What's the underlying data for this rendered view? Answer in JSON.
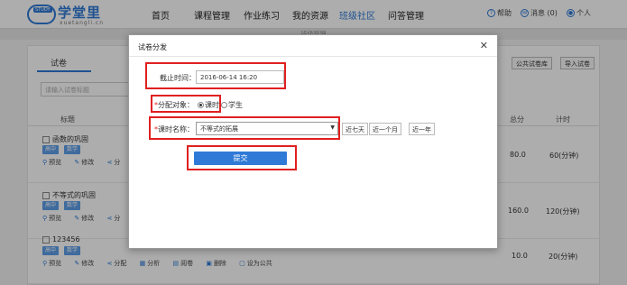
{
  "logo": {
    "badge": "STUDY",
    "name": "学堂里",
    "sub": "xuetangli.cn"
  },
  "nav": [
    {
      "label": "首页"
    },
    {
      "label": "课程管理"
    },
    {
      "label": "作业练习"
    },
    {
      "label": "我的资源"
    },
    {
      "label": "班级社区"
    },
    {
      "label": "问答管理"
    }
  ],
  "userbar": {
    "help": "帮助",
    "messages": "消息 (0)",
    "personal": "个人"
  },
  "subbar": {
    "label": "班级管理"
  },
  "page": {
    "tab": "试卷",
    "search_placeholder": "请输入试卷标题",
    "right_buttons": [
      "公共试卷库",
      "导入试卷"
    ],
    "columns": {
      "title": "标题",
      "total": "总分",
      "time": "计时"
    },
    "rows": [
      {
        "title": "函数的巩固",
        "tags": [
          "高中",
          "数学"
        ],
        "actions": [
          "预览",
          "修改",
          "分"
        ],
        "total": "80.0",
        "time": "60(分钟)"
      },
      {
        "title": "不等式的巩固",
        "tags": [
          "高中",
          "数学"
        ],
        "actions": [
          "预览",
          "修改",
          "分"
        ],
        "total": "160.0",
        "time": "120(分钟)"
      },
      {
        "title": "123456",
        "tags": [
          "高中",
          "数学"
        ],
        "actions": [
          "预览",
          "修改",
          "分配",
          "分析",
          "阅卷",
          "删除",
          "设为公共"
        ],
        "total": "10.0",
        "time": "20(分钟)"
      }
    ]
  },
  "modal": {
    "title": "试卷分发",
    "deadline_label": "截止时间：",
    "deadline_value": "2016-06-14 16:20",
    "target_label": "分配对象：",
    "target_options": [
      "课时",
      "学生"
    ],
    "lesson_label": "课时名称：",
    "lesson_selected": "不等式的拓展",
    "quick_ranges": [
      "近七天",
      "近一个月",
      "近一年"
    ],
    "submit": "提交"
  },
  "colors": {
    "accent": "#2f7ad6",
    "highlight": "#e02020"
  }
}
